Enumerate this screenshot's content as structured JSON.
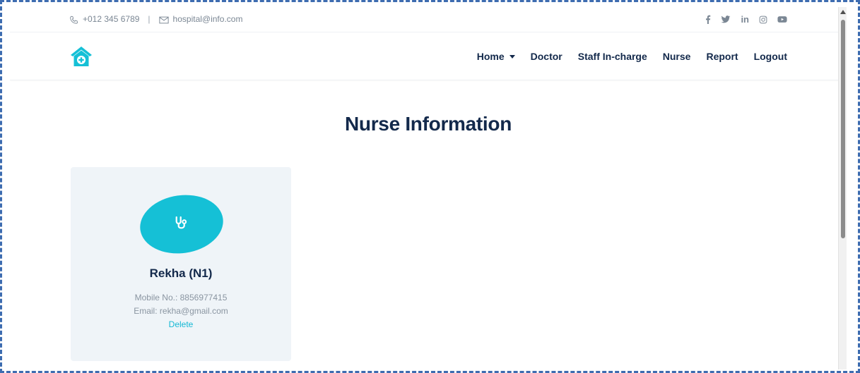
{
  "topbar": {
    "phone": "+012 345 6789",
    "separator": "|",
    "email": "hospital@info.com",
    "phone_icon": "phone-icon",
    "email_icon": "envelope-icon",
    "social": [
      "facebook-icon",
      "twitter-icon",
      "linkedin-icon",
      "instagram-icon",
      "youtube-icon"
    ]
  },
  "navbar": {
    "logo_icon": "hospital-house-icon",
    "links": [
      {
        "label": "Home",
        "has_dropdown": true
      },
      {
        "label": "Doctor"
      },
      {
        "label": "Staff In-charge"
      },
      {
        "label": "Nurse"
      },
      {
        "label": "Report"
      },
      {
        "label": "Logout"
      }
    ]
  },
  "page": {
    "title": "Nurse Information"
  },
  "nurses": [
    {
      "name": "Rekha (N1)",
      "mobile": "Mobile No.: 8856977415",
      "email": "Email: rekha@gmail.com",
      "delete_label": "Delete",
      "icon": "stethoscope-icon"
    }
  ],
  "colors": {
    "accent": "#15c0d6",
    "navy": "#13294b",
    "card_bg": "#eff4f8",
    "frame": "#3d6cb0"
  }
}
